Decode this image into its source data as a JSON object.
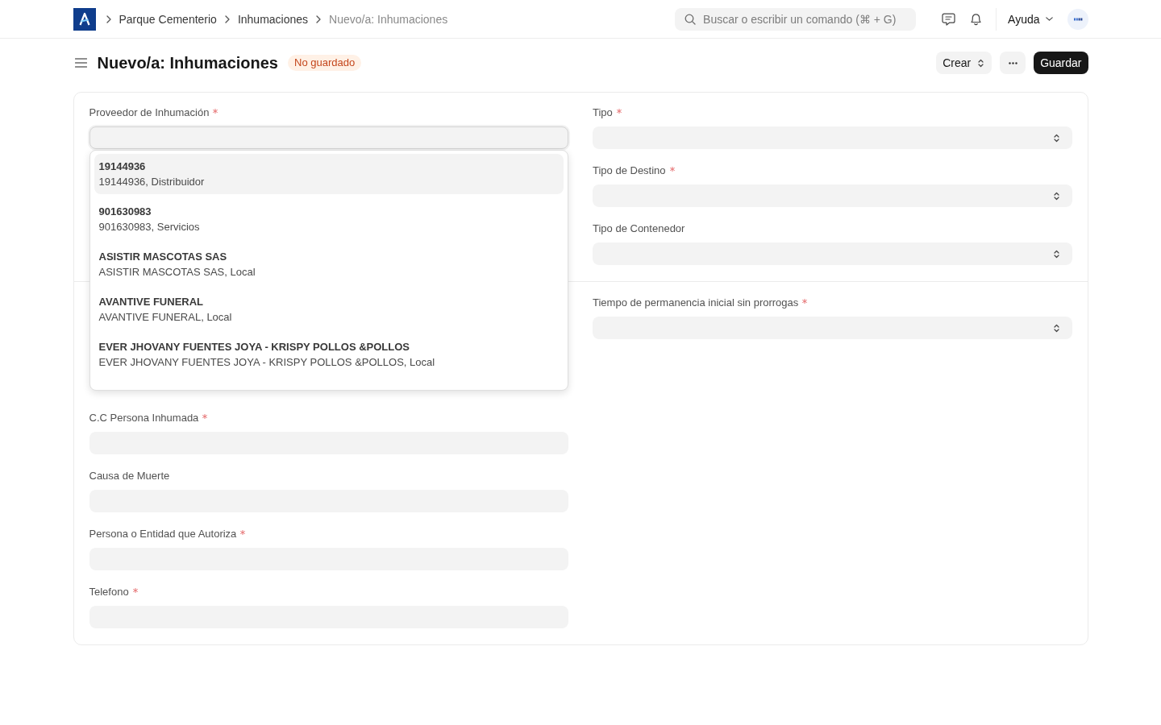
{
  "navbar": {
    "breadcrumbs": [
      {
        "label": "Parque Cementerio",
        "current": false
      },
      {
        "label": "Inhumaciones",
        "current": false
      },
      {
        "label": "Nuevo/a: Inhumaciones",
        "current": true
      }
    ],
    "search": {
      "placeholder": "Buscar o escribir un comando (⌘ + G)"
    },
    "help_menu": {
      "label": "Ayuda"
    }
  },
  "page_header": {
    "title": "Nuevo/a: Inhumaciones",
    "status": "No guardado",
    "actions": [
      {
        "kind": "menu",
        "label": "Crear"
      },
      {
        "kind": "more"
      },
      {
        "kind": "primary",
        "label": "Guardar"
      }
    ]
  },
  "form": {
    "sections": [
      {
        "columns": [
          [
            {
              "label": "Proveedor de Inhumación",
              "required": true,
              "kind": "text",
              "focused": true,
              "suggestions": [
                {
                  "title": "19144936",
                  "description": "19144936, Distribuidor",
                  "selected": true
                },
                {
                  "title": "901630983",
                  "description": "901630983, Servicios",
                  "selected": false
                },
                {
                  "title": "ASISTIR MASCOTAS SAS",
                  "description": "ASISTIR MASCOTAS SAS, Local",
                  "selected": false
                },
                {
                  "title": "AVANTIVE FUNERAL",
                  "description": "AVANTIVE FUNERAL, Local",
                  "selected": false
                },
                {
                  "title": "EVER JHOVANY FUENTES JOYA - KRISPY POLLOS &POLLOS",
                  "description": "EVER JHOVANY FUENTES JOYA - KRISPY POLLOS &POLLOS, Local",
                  "selected": false
                }
              ]
            }
          ],
          [
            {
              "label": "Tipo",
              "required": true,
              "kind": "select",
              "focused": false
            },
            {
              "label": "Tipo de Destino",
              "required": true,
              "kind": "select",
              "focused": false
            },
            {
              "label": "Tipo de Contenedor",
              "required": false,
              "kind": "select",
              "focused": false
            }
          ]
        ]
      },
      {
        "columns": [
          [
            {
              "label": "C.C Persona Inhumada",
              "required": true,
              "kind": "text",
              "focused": false
            },
            {
              "label": "Causa de Muerte",
              "required": false,
              "kind": "text",
              "focused": false
            },
            {
              "label": "Persona o Entidad que Autoriza",
              "required": true,
              "kind": "text",
              "focused": false
            },
            {
              "label": "Telefono",
              "required": true,
              "kind": "text",
              "focused": false
            }
          ],
          [
            {
              "label": "Tiempo de permanencia inicial sin prorrogas",
              "required": true,
              "kind": "select",
              "focused": false
            }
          ]
        ]
      }
    ]
  }
}
